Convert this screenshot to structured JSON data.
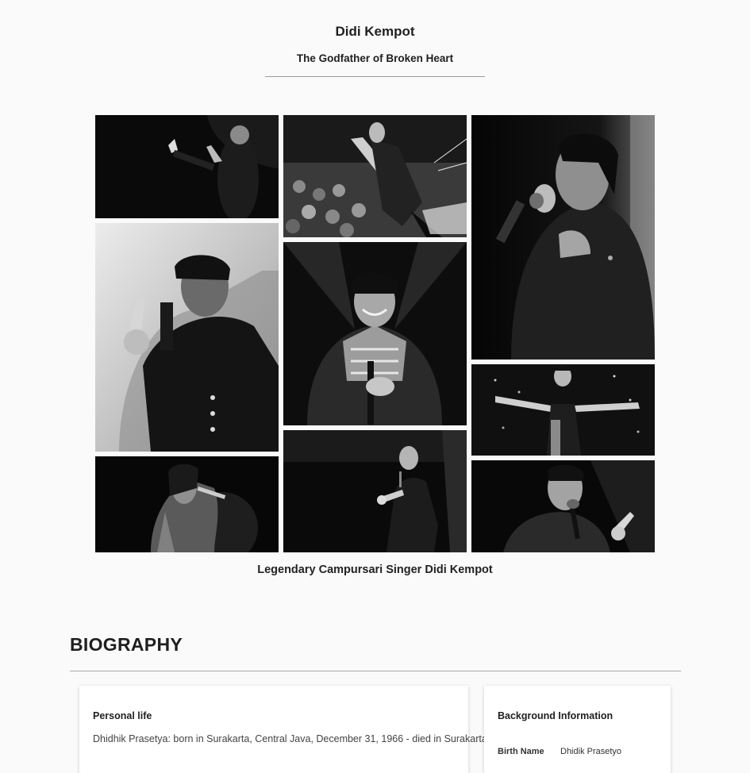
{
  "hero": {
    "title": "Didi Kempot",
    "subtitle": "The Godfather of Broken Heart"
  },
  "gallery": {
    "caption": "Legendary Campursari Singer Didi Kempot",
    "photos": [
      "singing-spotlight",
      "reaching-to-crowd",
      "closeup-hand-on-chest",
      "pointing-up-blangkon",
      "smiling-batik-jacket",
      "arms-outstretched",
      "singing-sequin-jacket",
      "stage-with-mic",
      "singing-gesturing-hand"
    ]
  },
  "biography": {
    "heading": "BIOGRAPHY",
    "personal": {
      "title": "Personal life",
      "text": "Dhidhik Prasetya: born in Surakarta, Central Java, December 31, 1966 - died in Surakarta,"
    },
    "background": {
      "title": "Background Information",
      "row_label": "Birth Name",
      "row_value": "Dhidik Prasetyo"
    }
  },
  "colors": {
    "background": "#fafafa",
    "text": "#1f1f1f",
    "rule": "#999999"
  }
}
